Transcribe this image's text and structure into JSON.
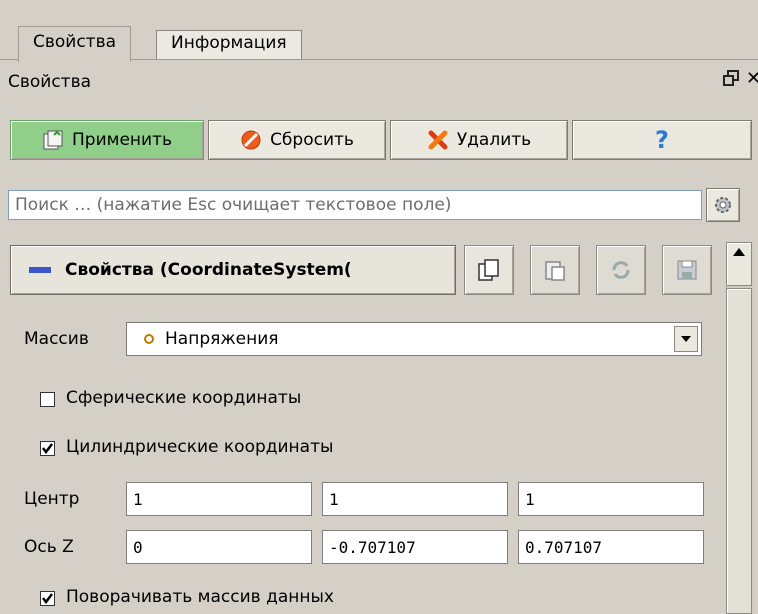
{
  "tabs": [
    {
      "label": "Свойства",
      "active": true
    },
    {
      "label": "Информация",
      "active": false
    }
  ],
  "panel": {
    "title": "Свойства"
  },
  "toolbar": {
    "apply_label": "Применить",
    "reset_label": "Сбросить",
    "delete_label": "Удалить",
    "help_glyph": "?"
  },
  "search": {
    "placeholder": "Поиск … (нажатие Esc очищает текстовое поле)"
  },
  "group": {
    "title": "Свойства (CoordinateSystem("
  },
  "properties": {
    "array_label": "Массив",
    "array_value": "Напряжения",
    "spherical_label": "Сферические координаты",
    "spherical_checked": false,
    "cylindrical_label": "Цилиндрические координаты",
    "cylindrical_checked": true,
    "center_label": "Центр",
    "center_values": [
      "1",
      "1",
      "1"
    ],
    "axis_label": "Ось Z",
    "axis_values": [
      "0",
      "-0.707107",
      "0.707107"
    ],
    "rotate_label": "Поворачивать массив данных",
    "rotate_checked": true
  },
  "colors": {
    "apply_bg": "#8fcf8a",
    "window_bg": "#d4d0c8",
    "accent_blue": "#3a56c8"
  }
}
